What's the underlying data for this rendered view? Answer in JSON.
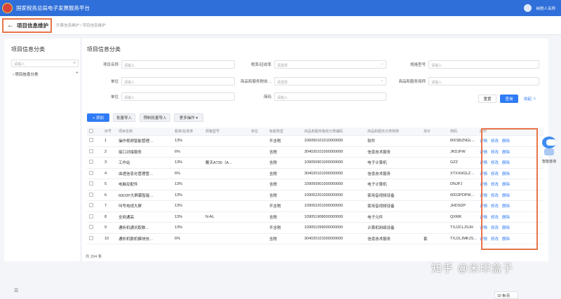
{
  "header": {
    "title": "国家税务总局电子发票服务平台",
    "user": "纳税人名称"
  },
  "breadcrumb": {
    "page_title": "项目信息维护",
    "path": "开票信息维护 / 项目信息维护"
  },
  "sidebar": {
    "title": "项目信息分类",
    "search_placeholder": "请输入",
    "tree_item": "项目信息分类"
  },
  "form": {
    "title": "项目信息分类",
    "fields": [
      {
        "label": "项目名称",
        "placeholder": "请输入"
      },
      {
        "label": "税率/征收率",
        "placeholder": "请选择"
      },
      {
        "label": "规格型号",
        "placeholder": "请输入"
      },
      {
        "label": "单位",
        "placeholder": "请输入"
      },
      {
        "label": "商品和服务税收…",
        "placeholder": "请选择"
      },
      {
        "label": "商品和服务简称",
        "placeholder": "请输入"
      },
      {
        "label": "单位",
        "placeholder": "请输入"
      },
      {
        "label": "简码",
        "placeholder": "请输入"
      }
    ],
    "reset_label": "重置",
    "query_label": "查询",
    "collapse_label": "收起 ∧"
  },
  "toolbar": {
    "add_label": "+ 添加",
    "batch_import_label": "批量导入",
    "preset_import_label": "预制批量导入",
    "more_label": "更多操作 ▾"
  },
  "table": {
    "headers": [
      "",
      "序号",
      "项目名称",
      "税率/征收率",
      "规格型号",
      "单位",
      "免税类型",
      "商品和服务税收分类编码",
      "商品和服务分类简称",
      "单价",
      "简码",
      "操作"
    ],
    "ops": [
      "详情",
      "修改",
      "删除"
    ],
    "rows": [
      [
        "1",
        "操作视频智能管理…",
        "13%",
        "",
        "",
        "不含税",
        "106050101010000000",
        "软件",
        "",
        "MXSBZNGL…"
      ],
      [
        "2",
        "接口对接服务",
        "6%",
        "",
        "",
        "含税",
        "304020101000000000",
        "信息技术服务",
        "",
        "JKDJFW"
      ],
      [
        "3",
        "工作站",
        "13%",
        "戴天A730（A…",
        "",
        "含税",
        "109050901000000000",
        "电子计算机",
        "",
        "GZZ"
      ],
      [
        "4",
        "血透信息化管理管…",
        "6%",
        "",
        "",
        "含税",
        "304020101000000000",
        "信息技术服务",
        "",
        "XTXXHGLZ…"
      ],
      [
        "5",
        "电脑及配件",
        "13%",
        "",
        "",
        "含税",
        "109050901000000000",
        "电子计算机",
        "",
        "DNJPJ"
      ],
      [
        "6",
        "60D2P大屏幕智能…",
        "13%",
        "",
        "",
        "含税",
        "109052201000000000",
        "家用音视频设备",
        "",
        "60D2PDPM…"
      ],
      [
        "7",
        "叫号电视大屏",
        "13%",
        "",
        "",
        "不含税",
        "109052201000000000",
        "家用音视频设备",
        "",
        "JHDSDP"
      ],
      [
        "8",
        "全网通高",
        "13%",
        "N-AL",
        "",
        "含税",
        "109051908000000000",
        "电子元件",
        "",
        "QXMK"
      ],
      [
        "9",
        "通析机通讯取数…",
        "13%",
        "",
        "",
        "不含税",
        "109051099000000000",
        "计算机网络设备",
        "",
        "TXJJCLJSJH"
      ],
      [
        "10",
        "通析机联机模块技…",
        "6%",
        "",
        "",
        "含税",
        "304020101000000000",
        "信息技术服务",
        "套",
        "TXJJLJMKJS…"
      ]
    ]
  },
  "footer": {
    "total": "共 204 条",
    "page_size": "10 条/页"
  },
  "assistant": {
    "label": "智能咨询"
  },
  "watermark": "知乎 @米印盒子"
}
